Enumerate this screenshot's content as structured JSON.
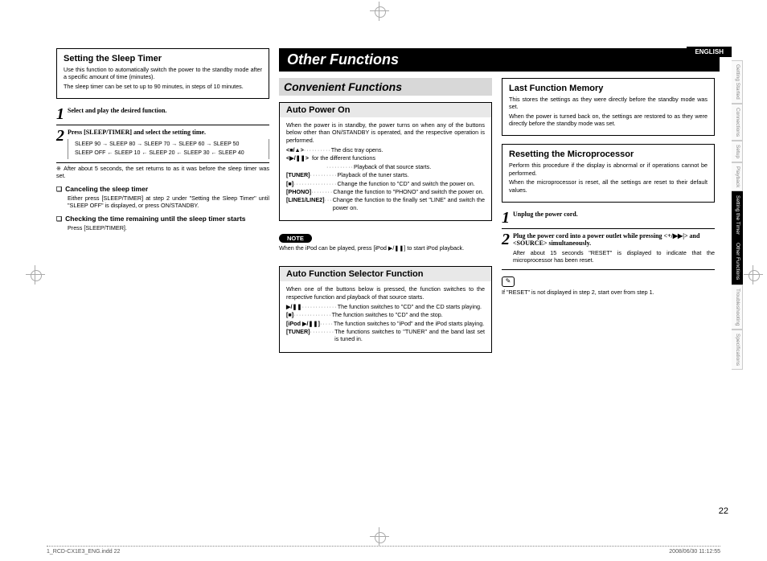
{
  "header": {
    "lang": "ENGLISH"
  },
  "side_tabs": [
    "Getting Started",
    "Connections",
    "Setup",
    "Playback",
    "Setting the Timer",
    "Other Functions",
    "Troubleshooting",
    "Specifications"
  ],
  "side_tabs_active": [
    4,
    5
  ],
  "left": {
    "title": "Setting the Sleep Timer",
    "intro1": "Use this function to automatically switch the power to the standby mode after a specific amount of time (minutes).",
    "intro2": "The sleep timer can be set to up to 90 minutes, in steps of 10 minutes.",
    "step1": "Select and play the desired function.",
    "step2": "Press [SLEEP/TIMER] and select the setting time.",
    "seq_top": "SLEEP 90 → SLEEP 80 → SLEEP 70 → SLEEP 60 → SLEEP 50",
    "seq_bot": "SLEEP OFF ← SLEEP 10 ← SLEEP 20 ← SLEEP 30 ← SLEEP 40",
    "note_after": "※ After about 5 seconds, the set returns to as it was before the sleep timer was set.",
    "cancel_h": "Canceling the sleep timer",
    "cancel_p": "Either press [SLEEP/TIMER] at step 2 under \"Setting the Sleep Timer\" until \"SLEEP OFF\" is displayed, or press ON/STANDBY.",
    "check_h": "Checking the time remaining until the sleep timer starts",
    "check_p": "Press [SLEEP/TIMER]."
  },
  "main": {
    "title": "Other Functions",
    "section": "Convenient Functions",
    "auto_power": {
      "title": "Auto Power On",
      "intro": "When the power is in standby, the power turns on when any of the buttons below other than ON/STANDBY is operated, and the respective operation is performed.",
      "items": [
        {
          "lab": "<■/▲>",
          "desc": "The disc tray opens."
        },
        {
          "lab": "<▶/❚❚>",
          "desc": "for the different functions"
        },
        {
          "lab": "",
          "desc": "Playback of that source starts."
        },
        {
          "lab": "[TUNER]",
          "desc": "Playback of the tuner starts."
        },
        {
          "lab": "[■]",
          "desc": "Change the function to \"CD\" and switch the power on."
        },
        {
          "lab": "[PHONO]",
          "desc": "Change the function to \"PHONO\" and switch the power on."
        },
        {
          "lab": "[LINE1/LINE2]",
          "desc": "Change the function to the finally set \"LINE\" and switch the power on."
        }
      ],
      "note_label": "NOTE",
      "note": "When the iPod can be played, press [iPod ▶/❚❚] to start iPod playback."
    },
    "auto_sel": {
      "title": "Auto Function Selector Function",
      "intro": "When one of the buttons below is pressed, the function switches to the respective function and playback of that source starts.",
      "items": [
        {
          "lab": "▶/❚❚",
          "desc": "The function switches to \"CD\" and the CD starts playing."
        },
        {
          "lab": "[■]",
          "desc": "The function switches to \"CD\" and the stop."
        },
        {
          "lab": "[iPod ▶/❚❚]",
          "desc": "The function switches to \"iPod\" and the iPod starts playing."
        },
        {
          "lab": "[TUNER]",
          "desc": "The functions switches to \"TUNER\" and the band last set is tuned in."
        }
      ]
    },
    "lastfn": {
      "title": "Last Function Memory",
      "p1": "This stores the settings as they were directly before the standby mode was set.",
      "p2": "When the power is turned back on, the settings are restored to as they were directly before the standby mode was set."
    },
    "reset": {
      "title": "Resetting the Microprocessor",
      "p1": "Perform this procedure if the display is abnormal or if operations cannot be performed.",
      "p2": "When the microprocessor is reset, all the settings are reset to their default values.",
      "step1": "Unplug the power cord.",
      "step2": "Plug the power cord into a power outlet while pressing <+/▶▶|> and <SOURCE> simultaneously.",
      "after": "After about 15 seconds \"RESET\" is displayed to indicate that the microprocessor has been reset.",
      "tip": "If \"RESET\" is not displayed in step 2, start over from step 1."
    }
  },
  "page_number": "22",
  "footer": {
    "left": "1_RCD-CX1E3_ENG.indd   22",
    "right": "2008/06/30   11:12:55"
  }
}
